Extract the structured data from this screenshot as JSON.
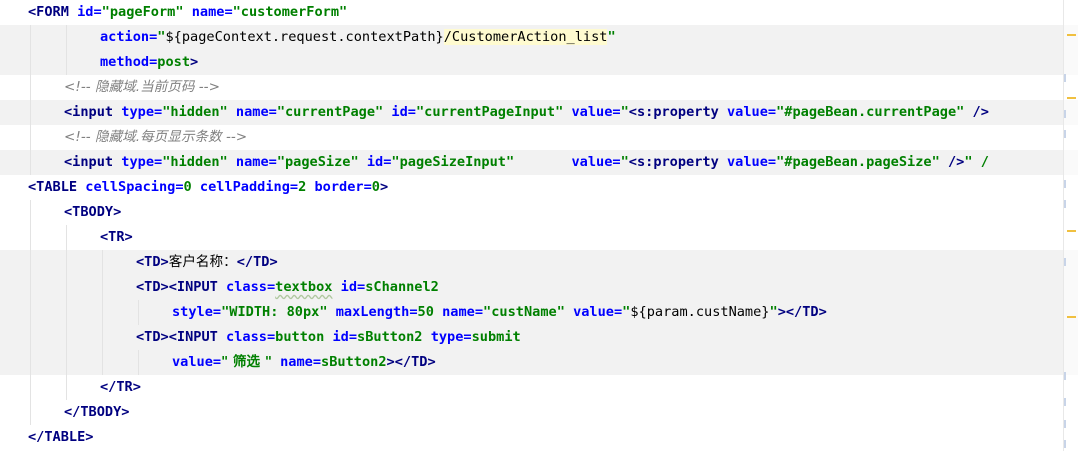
{
  "editor": {
    "language": "JSP",
    "highlighted_rows": [
      1,
      2,
      4,
      6,
      10,
      11,
      12,
      13,
      14
    ],
    "lines": [
      {
        "indent": 0,
        "tokens": [
          {
            "t": "<FORM ",
            "c": "tag"
          },
          {
            "t": "id=",
            "c": "attr"
          },
          {
            "t": "\"pageForm\"",
            "c": "str"
          },
          {
            "t": " ",
            "c": "text"
          },
          {
            "t": "name=",
            "c": "attr"
          },
          {
            "t": "\"customerForm\"",
            "c": "str"
          }
        ]
      },
      {
        "indent": 2,
        "tokens": [
          {
            "t": "action=",
            "c": "attr"
          },
          {
            "t": "\"",
            "c": "str"
          },
          {
            "t": "${pageContext.request.contextPath}",
            "c": "el"
          },
          {
            "t": "/CustomerAction_list",
            "c": "el-hl"
          },
          {
            "t": "\"",
            "c": "str"
          }
        ]
      },
      {
        "indent": 2,
        "tokens": [
          {
            "t": "method=",
            "c": "attr"
          },
          {
            "t": "post",
            "c": "str"
          },
          {
            "t": ">",
            "c": "tag"
          }
        ]
      },
      {
        "indent": 1,
        "tokens": [
          {
            "t": "<!-- 隐藏域.当前页码 -->",
            "c": "comment"
          }
        ]
      },
      {
        "indent": 1,
        "tokens": [
          {
            "t": "<input ",
            "c": "tag"
          },
          {
            "t": "type=",
            "c": "attr"
          },
          {
            "t": "\"hidden\"",
            "c": "str"
          },
          {
            "t": " ",
            "c": "text"
          },
          {
            "t": "name=",
            "c": "attr"
          },
          {
            "t": "\"currentPage\"",
            "c": "str"
          },
          {
            "t": " ",
            "c": "text"
          },
          {
            "t": "id=",
            "c": "attr"
          },
          {
            "t": "\"currentPageInput\"",
            "c": "str"
          },
          {
            "t": " ",
            "c": "text"
          },
          {
            "t": "value=",
            "c": "attr"
          },
          {
            "t": "\"",
            "c": "str"
          },
          {
            "t": "<s:property ",
            "c": "tag"
          },
          {
            "t": "value=",
            "c": "attr"
          },
          {
            "t": "\"#pageBean.currentPage\"",
            "c": "str"
          },
          {
            "t": " />",
            "c": "tag"
          }
        ]
      },
      {
        "indent": 1,
        "tokens": [
          {
            "t": "<!-- 隐藏域.每页显示条数 -->",
            "c": "comment"
          }
        ]
      },
      {
        "indent": 1,
        "tokens": [
          {
            "t": "<input ",
            "c": "tag"
          },
          {
            "t": "type=",
            "c": "attr"
          },
          {
            "t": "\"hidden\"",
            "c": "str"
          },
          {
            "t": " ",
            "c": "text"
          },
          {
            "t": "name=",
            "c": "attr"
          },
          {
            "t": "\"pageSize\"",
            "c": "str"
          },
          {
            "t": " ",
            "c": "text"
          },
          {
            "t": "id=",
            "c": "attr"
          },
          {
            "t": "\"pageSizeInput\"",
            "c": "str"
          },
          {
            "t": "       ",
            "c": "text"
          },
          {
            "t": "value=",
            "c": "attr"
          },
          {
            "t": "\"",
            "c": "str"
          },
          {
            "t": "<s:property ",
            "c": "tag"
          },
          {
            "t": "value=",
            "c": "attr"
          },
          {
            "t": "\"#pageBean.pageSize\"",
            "c": "str"
          },
          {
            "t": " />",
            "c": "tag"
          },
          {
            "t": "\" /",
            "c": "str"
          }
        ]
      },
      {
        "indent": 0,
        "tokens": [
          {
            "t": "<TABLE ",
            "c": "tag"
          },
          {
            "t": "cellSpacing=",
            "c": "attr"
          },
          {
            "t": "0",
            "c": "str"
          },
          {
            "t": " ",
            "c": "text"
          },
          {
            "t": "cellPadding=",
            "c": "attr"
          },
          {
            "t": "2",
            "c": "str"
          },
          {
            "t": " ",
            "c": "text"
          },
          {
            "t": "border=",
            "c": "attr"
          },
          {
            "t": "0",
            "c": "str"
          },
          {
            "t": ">",
            "c": "tag"
          }
        ]
      },
      {
        "indent": 1,
        "tokens": [
          {
            "t": "<TBODY>",
            "c": "tag"
          }
        ]
      },
      {
        "indent": 2,
        "tokens": [
          {
            "t": "<TR>",
            "c": "tag"
          }
        ]
      },
      {
        "indent": 3,
        "tokens": [
          {
            "t": "<TD>",
            "c": "tag"
          },
          {
            "t": "客户名称：",
            "c": "text"
          },
          {
            "t": "</TD>",
            "c": "tag"
          }
        ]
      },
      {
        "indent": 3,
        "tokens": [
          {
            "t": "<TD>",
            "c": "tag"
          },
          {
            "t": "<INPUT ",
            "c": "tag"
          },
          {
            "t": "class=",
            "c": "attr"
          },
          {
            "t": "textbox",
            "c": "warn"
          },
          {
            "t": " ",
            "c": "text"
          },
          {
            "t": "id=",
            "c": "attr"
          },
          {
            "t": "sChannel2",
            "c": "str"
          }
        ]
      },
      {
        "indent": 4,
        "tokens": [
          {
            "t": "style=",
            "c": "attr"
          },
          {
            "t": "\"WIDTH: 80px\"",
            "c": "str"
          },
          {
            "t": " ",
            "c": "text"
          },
          {
            "t": "maxLength=",
            "c": "attr"
          },
          {
            "t": "50",
            "c": "str"
          },
          {
            "t": " ",
            "c": "text"
          },
          {
            "t": "name=",
            "c": "attr"
          },
          {
            "t": "\"custName\"",
            "c": "str"
          },
          {
            "t": " ",
            "c": "text"
          },
          {
            "t": "value=",
            "c": "attr"
          },
          {
            "t": "\"",
            "c": "str"
          },
          {
            "t": "${param.custName}",
            "c": "el"
          },
          {
            "t": "\"",
            "c": "str"
          },
          {
            "t": "></TD>",
            "c": "tag"
          }
        ]
      },
      {
        "indent": 3,
        "tokens": [
          {
            "t": "<TD>",
            "c": "tag"
          },
          {
            "t": "<INPUT ",
            "c": "tag"
          },
          {
            "t": "class=",
            "c": "attr"
          },
          {
            "t": "button",
            "c": "str"
          },
          {
            "t": " ",
            "c": "text"
          },
          {
            "t": "id=",
            "c": "attr"
          },
          {
            "t": "sButton2",
            "c": "str"
          },
          {
            "t": " ",
            "c": "text"
          },
          {
            "t": "type=",
            "c": "attr"
          },
          {
            "t": "submit",
            "c": "str"
          }
        ]
      },
      {
        "indent": 4,
        "tokens": [
          {
            "t": "value=",
            "c": "attr"
          },
          {
            "t": "\" 筛选 \"",
            "c": "str"
          },
          {
            "t": " ",
            "c": "text"
          },
          {
            "t": "name=",
            "c": "attr"
          },
          {
            "t": "sButton2",
            "c": "str"
          },
          {
            "t": "></TD>",
            "c": "tag"
          }
        ]
      },
      {
        "indent": 2,
        "tokens": [
          {
            "t": "</TR>",
            "c": "tag"
          }
        ]
      },
      {
        "indent": 1,
        "tokens": [
          {
            "t": "</TBODY>",
            "c": "tag"
          }
        ]
      },
      {
        "indent": 0,
        "tokens": [
          {
            "t": "</TABLE>",
            "c": "tag"
          }
        ]
      }
    ]
  },
  "colors": {
    "tag": "#000080",
    "attribute": "#0000ff",
    "string": "#008000",
    "comment": "#808080",
    "highlight_row": "#f2f2f2",
    "warning_stripe": "#f0c040"
  }
}
